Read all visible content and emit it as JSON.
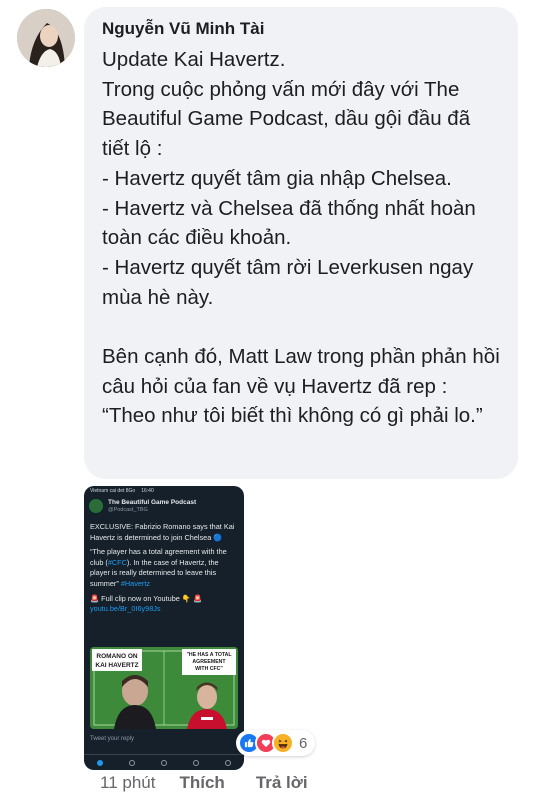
{
  "comment": {
    "author": "Nguyễn Vũ Minh Tài",
    "text": "Update Kai Havertz.\nTrong cuộc phỏng vấn mới đây với The Beautiful Game Podcast, dầu gội đầu đã tiết lộ :\n- Havertz quyết tâm gia nhập Chelsea.\n- Havertz và Chelsea đã thống nhất hoàn toàn các điều khoản.\n- Havertz quyết tâm rời Leverkusen ngay mùa hè này.\n\nBên cạnh đó, Matt Law trong phần phản hồi câu hỏi của fan về vụ Havertz đã rep :\n“Theo như tôi biết thì không có gì phải lo.”"
  },
  "attachment": {
    "status_carrier": "Vietnam cai det 8Go",
    "status_time": "16:40",
    "account_name": "The Beautiful Game Podcast",
    "account_handle": "@Podcast_TBG",
    "tweet_line1": "EXCLUSIVE: Fabrizio Romano says that Kai Havertz is determined to join Chelsea 🔵",
    "tweet_line2_pre": "“The player has a total agreement with the club (",
    "tweet_line2_tag": "#CFC",
    "tweet_line2_post": "). In the case of Havertz, the player is really determined to leave this summer” ",
    "tweet_line2_hashtag": "#Havertz",
    "tweet_line3": "🚨 Full clip now on Youtube 👇 🚨",
    "tweet_link": "youtu.be/Br_0I6y98Js",
    "media_left_caption": "ROMANO ON KAI HAVERTZ",
    "media_right_caption": "\"HE HAS A TOTAL AGREEMENT WITH CFC\"",
    "reply_placeholder": "Tweet your reply"
  },
  "reactions": {
    "icons": [
      "like-icon",
      "love-icon",
      "haha-icon"
    ],
    "count": "6"
  },
  "meta": {
    "time": "11 phút",
    "like_label": "Thích",
    "reply_label": "Trả lời"
  },
  "colors": {
    "bubble": "#f0f2f5",
    "like_blue": "#1877f2",
    "love_red": "#f33e58",
    "haha_yellow": "#f7b125",
    "twitter_dark": "#15202b"
  }
}
